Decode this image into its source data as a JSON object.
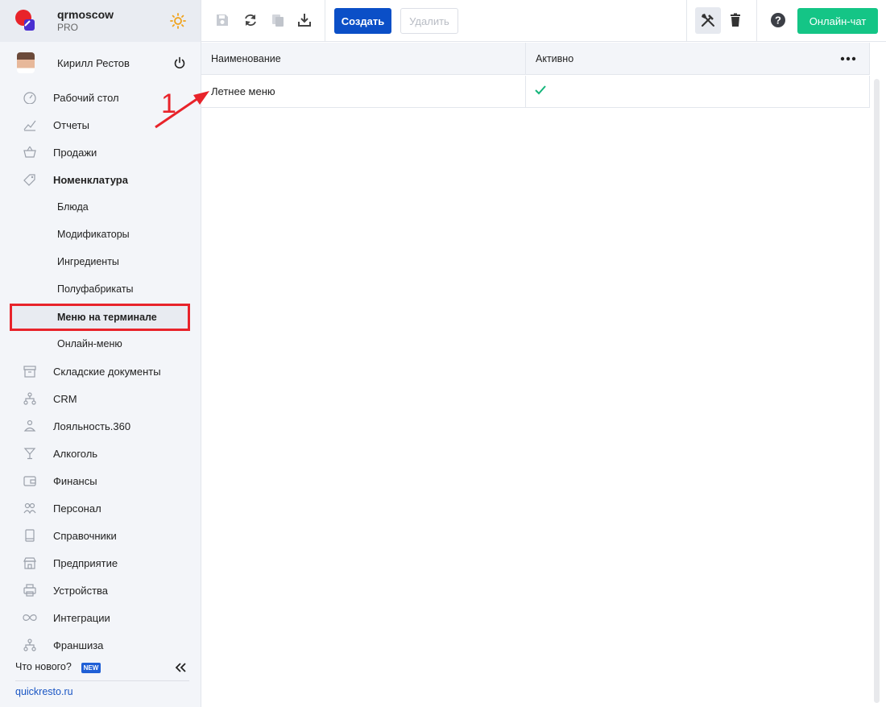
{
  "brand": {
    "name": "qrmoscow",
    "plan": "PRO"
  },
  "user": {
    "name": "Кирилл Рестов"
  },
  "nav": {
    "items": [
      {
        "label": "Рабочий стол",
        "icon": "dashboard-icon"
      },
      {
        "label": "Отчеты",
        "icon": "chart-icon"
      },
      {
        "label": "Продажи",
        "icon": "basket-icon"
      },
      {
        "label": "Номенклатура",
        "icon": "tag-icon"
      },
      {
        "label": "Складские документы",
        "icon": "archive-icon"
      },
      {
        "label": "CRM",
        "icon": "hierarchy-icon"
      },
      {
        "label": "Лояльность.360",
        "icon": "loyalty-icon"
      },
      {
        "label": "Алкоголь",
        "icon": "cocktail-icon"
      },
      {
        "label": "Финансы",
        "icon": "wallet-icon"
      },
      {
        "label": "Персонал",
        "icon": "people-icon"
      },
      {
        "label": "Справочники",
        "icon": "book-icon"
      },
      {
        "label": "Предприятие",
        "icon": "store-icon"
      },
      {
        "label": "Устройства",
        "icon": "printer-icon"
      },
      {
        "label": "Интеграции",
        "icon": "infinity-icon"
      },
      {
        "label": "Франшиза",
        "icon": "hierarchy-icon"
      }
    ],
    "sub_items": [
      {
        "label": "Блюда"
      },
      {
        "label": "Модификаторы"
      },
      {
        "label": "Ингредиенты"
      },
      {
        "label": "Полуфабрикаты"
      },
      {
        "label": "Меню на терминале"
      },
      {
        "label": "Онлайн-меню"
      }
    ]
  },
  "footer": {
    "whats_new": "Что нового?",
    "badge": "NEW",
    "site": "quickresto.ru"
  },
  "toolbar": {
    "create_label": "Создать",
    "delete_label": "Удалить",
    "chat_label": "Онлайн-чат"
  },
  "table": {
    "columns": [
      "Наименование",
      "Активно"
    ],
    "rows": [
      {
        "name": "Летнее меню",
        "active": true
      }
    ]
  },
  "annotation": {
    "number": "1",
    "color": "#e8232a"
  },
  "colors": {
    "accent": "#0b4fc7",
    "chat": "#14c586",
    "highlight": "#e8232a"
  }
}
